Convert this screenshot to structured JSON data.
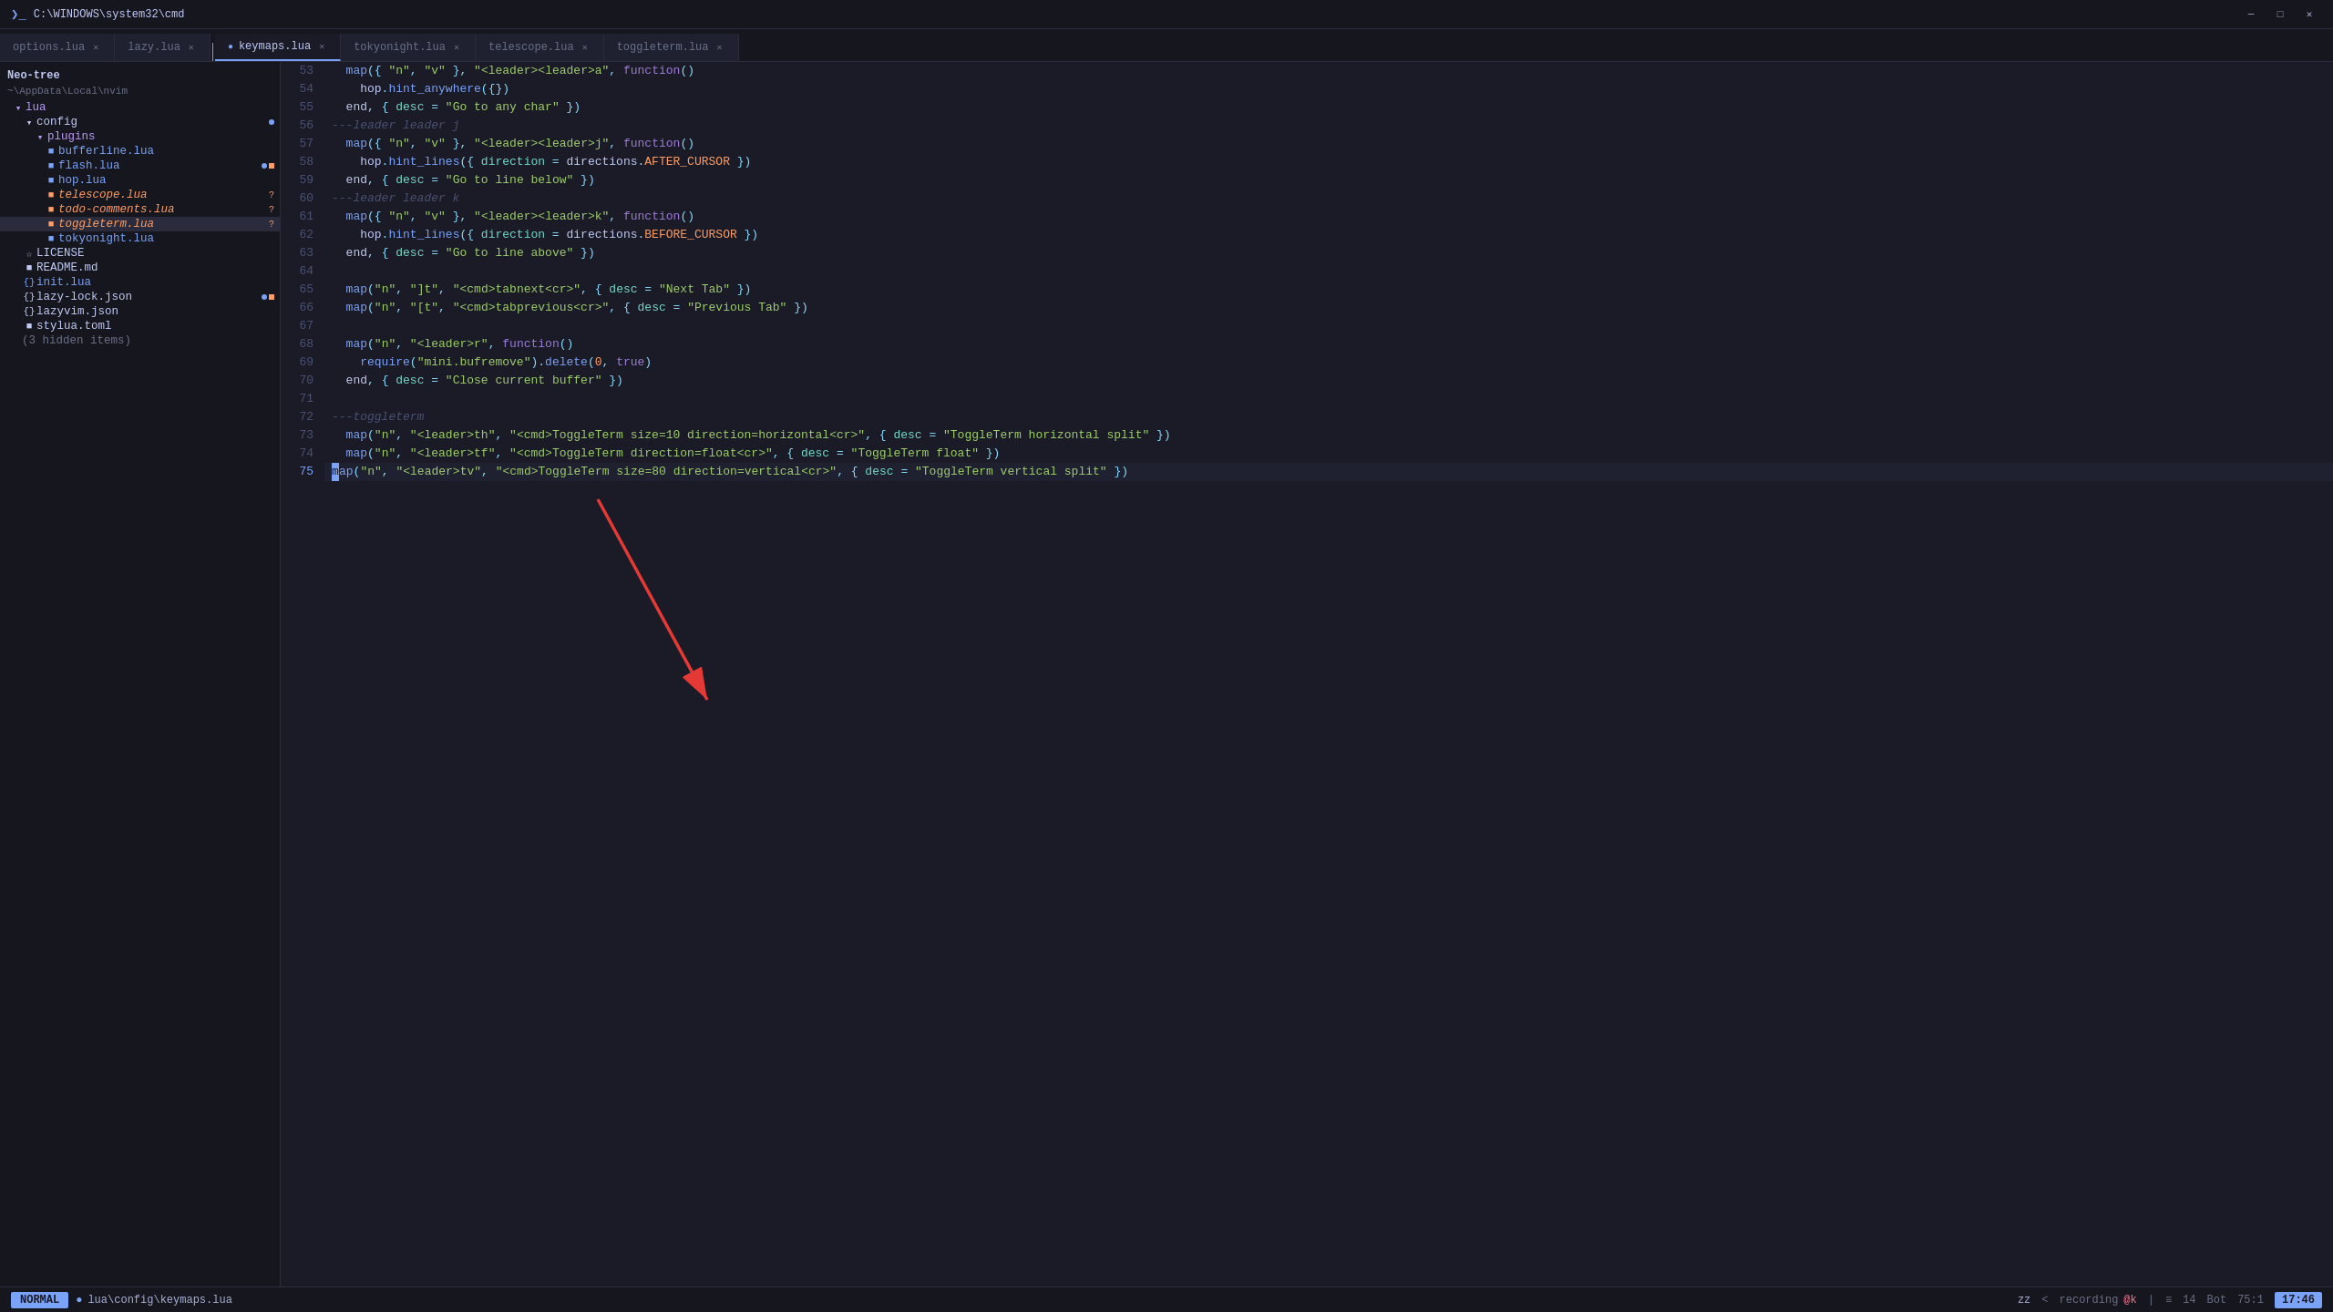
{
  "titlebar": {
    "icon": "❯",
    "title": "C:\\WINDOWS\\system32\\cmd",
    "minimize": "─",
    "maximize": "□",
    "close": "✕"
  },
  "tabs": [
    {
      "id": "options",
      "label": "options.lua",
      "active": false,
      "dot": false
    },
    {
      "id": "lazy",
      "label": "lazy.lua",
      "active": false,
      "dot": false
    },
    {
      "id": "keymaps",
      "label": "keymaps.lua",
      "active": true,
      "dot": false
    },
    {
      "id": "tokyonight",
      "label": "tokyonight.lua",
      "active": false,
      "dot": false
    },
    {
      "id": "telescope",
      "label": "telescope.lua",
      "active": false,
      "dot": false
    },
    {
      "id": "toggleterm",
      "label": "toggleterm.lua",
      "active": false,
      "dot": false
    }
  ],
  "sidebar": {
    "header": "Neo-tree",
    "path": "~\\AppData\\Local\\nvim",
    "items": [
      {
        "indent": 0,
        "icon": "▾",
        "label": "lua",
        "color": "purple",
        "badge": ""
      },
      {
        "indent": 1,
        "icon": "▾",
        "label": "config",
        "color": "white",
        "badge": "dot-blue"
      },
      {
        "indent": 2,
        "icon": "▾",
        "label": "plugins",
        "color": "purple",
        "badge": ""
      },
      {
        "indent": 3,
        "icon": "■",
        "label": "bufferline.lua",
        "color": "blue",
        "badge": ""
      },
      {
        "indent": 3,
        "icon": "■",
        "label": "flash.lua",
        "color": "blue",
        "badge": "dot-blue square-orange"
      },
      {
        "indent": 3,
        "icon": "■",
        "label": "hop.lua",
        "color": "blue",
        "badge": ""
      },
      {
        "indent": 3,
        "icon": "■",
        "label": "telescope.lua",
        "color": "orange",
        "badge": "?"
      },
      {
        "indent": 3,
        "icon": "■",
        "label": "todo-comments.lua",
        "color": "orange",
        "badge": "?"
      },
      {
        "indent": 3,
        "icon": "■",
        "label": "toggleterm.lua",
        "color": "orange",
        "badge": "?",
        "selected": true
      },
      {
        "indent": 3,
        "icon": "■",
        "label": "tokyonight.lua",
        "color": "blue",
        "badge": ""
      },
      {
        "indent": 1,
        "icon": "☆",
        "label": "LICENSE",
        "color": "white",
        "badge": ""
      },
      {
        "indent": 1,
        "icon": "■",
        "label": "README.md",
        "color": "white",
        "badge": ""
      },
      {
        "indent": 1,
        "icon": "{ }",
        "label": "init.lua",
        "color": "blue",
        "badge": ""
      },
      {
        "indent": 1,
        "icon": "{ }",
        "label": "lazy-lock.json",
        "color": "white",
        "badge": "dot-blue square-orange"
      },
      {
        "indent": 1,
        "icon": "{ }",
        "label": "lazyvim.json",
        "color": "white",
        "badge": ""
      },
      {
        "indent": 1,
        "icon": "■",
        "label": "stylua.toml",
        "color": "white",
        "badge": ""
      },
      {
        "indent": 1,
        "icon": "",
        "label": "(3 hidden items)",
        "color": "gray",
        "badge": ""
      }
    ]
  },
  "editor": {
    "lines": [
      {
        "num": 53,
        "content": "  map({ \"n\", \"v\" }, \"<leader><leader>a\", function()"
      },
      {
        "num": 54,
        "content": "    hop.hint_anywhere({})"
      },
      {
        "num": 55,
        "content": "  end, { desc = \"Go to any char\" })"
      },
      {
        "num": 56,
        "content": "---leader leader j"
      },
      {
        "num": 57,
        "content": "  map({ \"n\", \"v\" }, \"<leader><leader>j\", function()"
      },
      {
        "num": 58,
        "content": "    hop.hint_lines({ direction = directions.AFTER_CURSOR })"
      },
      {
        "num": 59,
        "content": "  end, { desc = \"Go to line below\" })"
      },
      {
        "num": 60,
        "content": "---leader leader k"
      },
      {
        "num": 61,
        "content": "  map({ \"n\", \"v\" }, \"<leader><leader>k\", function()"
      },
      {
        "num": 62,
        "content": "    hop.hint_lines({ direction = directions.BEFORE_CURSOR })"
      },
      {
        "num": 63,
        "content": "  end, { desc = \"Go to line above\" })"
      },
      {
        "num": 64,
        "content": ""
      },
      {
        "num": 65,
        "content": "  map(\"n\", \"]t\", \"<cmd>tabnext<cr>\", { desc = \"Next Tab\" })"
      },
      {
        "num": 66,
        "content": "  map(\"n\", \"[t\", \"<cmd>tabprevious<cr>\", { desc = \"Previous Tab\" })"
      },
      {
        "num": 67,
        "content": ""
      },
      {
        "num": 68,
        "content": "  map(\"n\", \"<leader>r\", function()"
      },
      {
        "num": 69,
        "content": "    require(\"mini.bufremove\").delete(0, true)"
      },
      {
        "num": 70,
        "content": "  end, { desc = \"Close current buffer\" })"
      },
      {
        "num": 71,
        "content": ""
      },
      {
        "num": 72,
        "content": "---toggleterm"
      },
      {
        "num": 73,
        "content": "  map(\"n\", \"<leader>th\", \"<cmd>ToggleTerm size=10 direction=horizontal<cr>\", { desc = \"ToggleTerm horizontal split\" })"
      },
      {
        "num": 74,
        "content": "  map(\"n\", \"<leader>tf\", \"<cmd>ToggleTerm direction=float<cr>\", { desc = \"ToggleTerm float\" })"
      },
      {
        "num": 75,
        "content": "  map(\"n\", \"<leader>tv\", \"<cmd>ToggleTerm size=80 direction=vertical<cr>\", { desc = \"ToggleTerm vertical split\" })"
      }
    ]
  },
  "statusbar": {
    "mode": "NORMAL",
    "file_icon": "●",
    "file_path": "lua\\config\\keymaps.lua",
    "zz": "zz",
    "chevron_left": "<",
    "recording": "recording",
    "macro_key": "@k",
    "separator": "|",
    "line_count": "14",
    "bot": "Bot",
    "position": "75:1",
    "clock": "17:46"
  }
}
